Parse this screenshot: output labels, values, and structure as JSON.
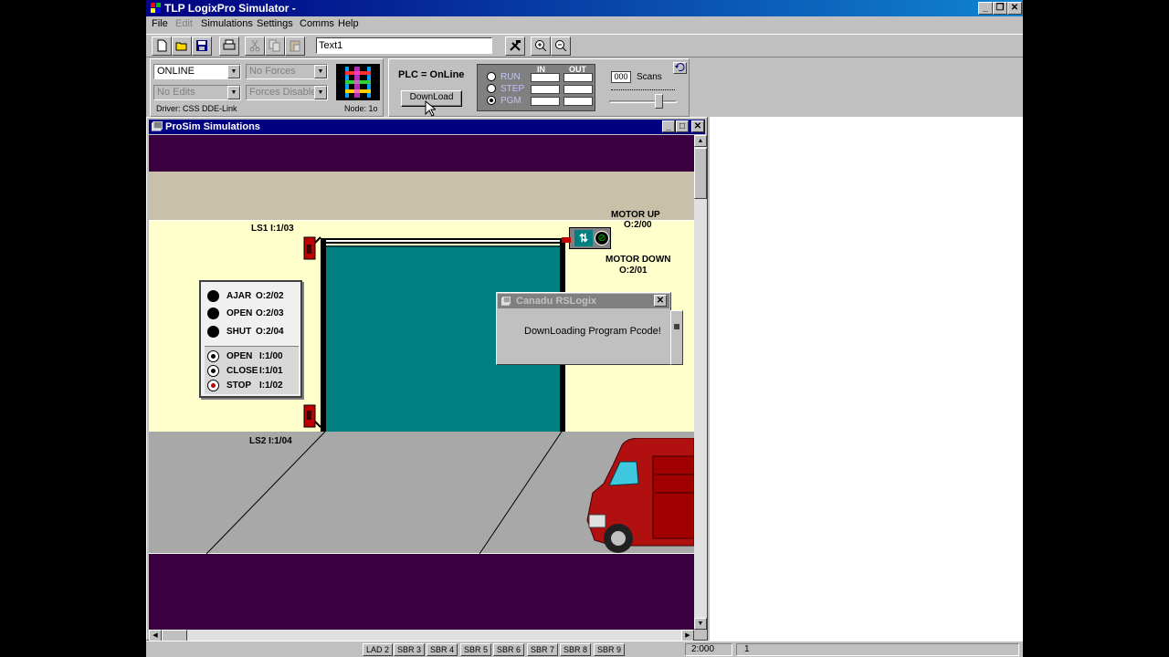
{
  "app": {
    "title": "TLP LogixPro Simulator  -",
    "menu": [
      "File",
      "Edit",
      "Simulations",
      "Settings",
      "Comms",
      "Help"
    ],
    "toolbar_text_value": "Text1"
  },
  "controls": {
    "mode_value": "ONLINE",
    "forces_value": "No Forces",
    "edits_value": "No Edits",
    "forces_enabled_value": "Forces Disabled",
    "driver_text": "Driver: CSS DDE-Link",
    "node_text": "Node: 1o",
    "plc_status": "PLC = OnLine",
    "download_label": "DownLoad",
    "io_in_label": "IN",
    "io_out_label": "OUT",
    "run_label": "RUN",
    "step_label": "STEP",
    "pgm_label": "PGM",
    "selected_mode": "PGM",
    "scans_value": "000",
    "scans_label": "Scans"
  },
  "child_window": {
    "title": "ProSim Simulations",
    "scene": {
      "ls1": "LS1  I:1/03",
      "ls2": "LS2  I:1/04",
      "motor_up": "MOTOR UP",
      "motor_up_addr": "O:2/00",
      "motor_down": "MOTOR DOWN",
      "motor_down_addr": "O:2/01",
      "indicators": [
        {
          "label": "AJAR",
          "addr": "O:2/02"
        },
        {
          "label": "OPEN",
          "addr": "O:2/03"
        },
        {
          "label": "SHUT",
          "addr": "O:2/04"
        }
      ],
      "buttons": [
        {
          "label": "OPEN",
          "addr": "I:1/00"
        },
        {
          "label": "CLOSE",
          "addr": "I:1/01"
        },
        {
          "label": "STOP",
          "addr": "I:1/02"
        }
      ]
    }
  },
  "dialog": {
    "title": "Canadu RSLogix",
    "message": "DownLoading Program Pcode!"
  },
  "statusbar": {
    "tabs": [
      "LAD 2",
      "SBR 3",
      "SBR 4",
      "SBR 5",
      "SBR 6",
      "SBR 7",
      "SBR 8",
      "SBR 9"
    ],
    "position": "2:000",
    "count": "1"
  },
  "colors": {
    "door": "#008080",
    "wall": "#ffffcc",
    "floor": "#a0a0a0",
    "night": "#3a0040",
    "truck": "#b01010"
  }
}
